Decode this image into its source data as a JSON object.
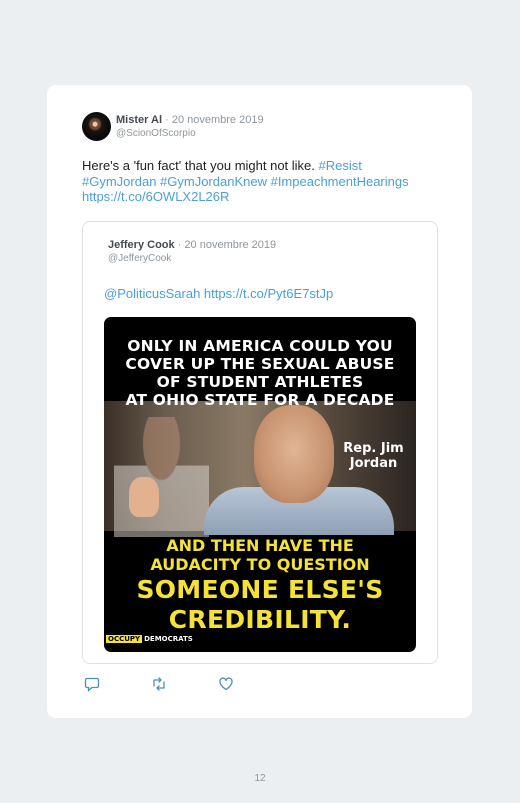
{
  "tweet": {
    "author": "Mister Al",
    "date": "20 novembre 2019",
    "handle": "@ScionOfScorpio",
    "text_plain": "Here's a 'fun fact' that you might not like. ",
    "hashtag_resist": "#Resist",
    "hashtags_line": "#GymJordan #GymJordanKnew #ImpeachmentHearings",
    "link": "https://t.co/6OWLX2L26R"
  },
  "quote": {
    "author": "Jeffery Cook",
    "date": "20 novembre 2019",
    "handle": "@JefferyCook",
    "mention": "@PoliticusSarah",
    "link": "https://t.co/Pyt6E7stJp"
  },
  "image": {
    "caption_top": [
      "ONLY IN AMERICA COULD YOU",
      "COVER UP THE SEXUAL ABUSE",
      "OF STUDENT ATHLETES",
      "AT OHIO STATE FOR A DECADE"
    ],
    "label_rep": [
      "Rep. Jim",
      "Jordan"
    ],
    "caption_mid": [
      "AND THEN HAVE THE",
      "AUDACITY TO QUESTION"
    ],
    "caption_bottom": [
      "SOMEONE ELSE'S",
      "CREDIBILITY."
    ],
    "brand_a": "OCCUPY",
    "brand_b": "DEMOCRATS"
  },
  "actions": {
    "reply_icon": "reply-icon",
    "retweet_icon": "retweet-icon",
    "like_icon": "heart-icon"
  },
  "page_number": "12"
}
